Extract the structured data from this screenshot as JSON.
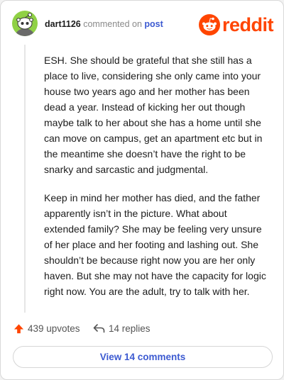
{
  "header": {
    "username": "dart1126",
    "action_text": "commented on",
    "post_link": "post",
    "logo_text": "reddit"
  },
  "comment": {
    "paragraphs": [
      "ESH. She should be grateful that she still has a place to live, considering she only came into your house two years ago and her mother has been dead a year. Instead of kicking her out though maybe talk to her about she has a home until she can move on campus, get an apartment etc but in the meantime she doesn’t have the right to be snarky and sarcastic and judgmental.",
      "Keep in mind her mother has died, and the father apparently isn’t in the picture. What about extended family? She may be feeling very unsure of her place and her footing and lashing out. She shouldn’t be because right now you are her only haven. But she may not have the capacity for logic right now. You are the adult, try to talk with her."
    ]
  },
  "actions": {
    "upvotes": "439 upvotes",
    "replies": "14 replies",
    "view_comments": "View 14 comments"
  },
  "icons": {
    "upvote": "upvote-arrow-icon",
    "reply": "reply-arrow-icon",
    "logo": "reddit-snoo-icon",
    "avatar": "snoo-avatar-icon"
  },
  "colors": {
    "brand": "#ff4500",
    "link": "#3c5ad1",
    "avatar_bg": "#90d145"
  }
}
